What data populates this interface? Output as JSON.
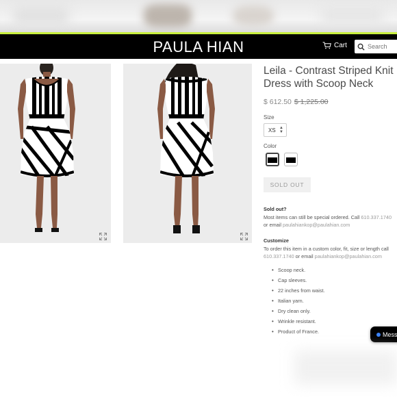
{
  "header": {
    "brand": "PAULA HIAN",
    "cart_label": "Cart",
    "search_placeholder": "Search"
  },
  "product": {
    "title": "Leila - Contrast Striped Knit Dress with Scoop Neck",
    "price": "$ 612.50",
    "compare_price": "$ 1,225.00",
    "size_label": "Size",
    "size_value": "XS",
    "color_label": "Color",
    "sold_out_button": "SOLD OUT"
  },
  "sold_out_note": {
    "heading": "Sold out?",
    "text_before": "Most items can still be special ordered. Call ",
    "phone": "610.337.1740",
    "text_mid": " or email ",
    "email": "paulahiankop@paulahian.com"
  },
  "customize": {
    "heading": "Customize",
    "text_before": "To order this item in a custom color, fit, size or length call ",
    "phone": "610.337.1740",
    "text_mid": " or email ",
    "email": "paulahiankop@paulahian.com"
  },
  "features": [
    "Scoop neck.",
    "Cap sleeves.",
    "22 inches from waist.",
    "Italian yarn.",
    "Dry clean only.",
    "Wrinkle resistant.",
    "Product of France."
  ],
  "chat_button": "Mess",
  "colors": {
    "header_bg": "#000000",
    "accent_line": "#c8ef3e",
    "link": "#9a9a9a"
  }
}
